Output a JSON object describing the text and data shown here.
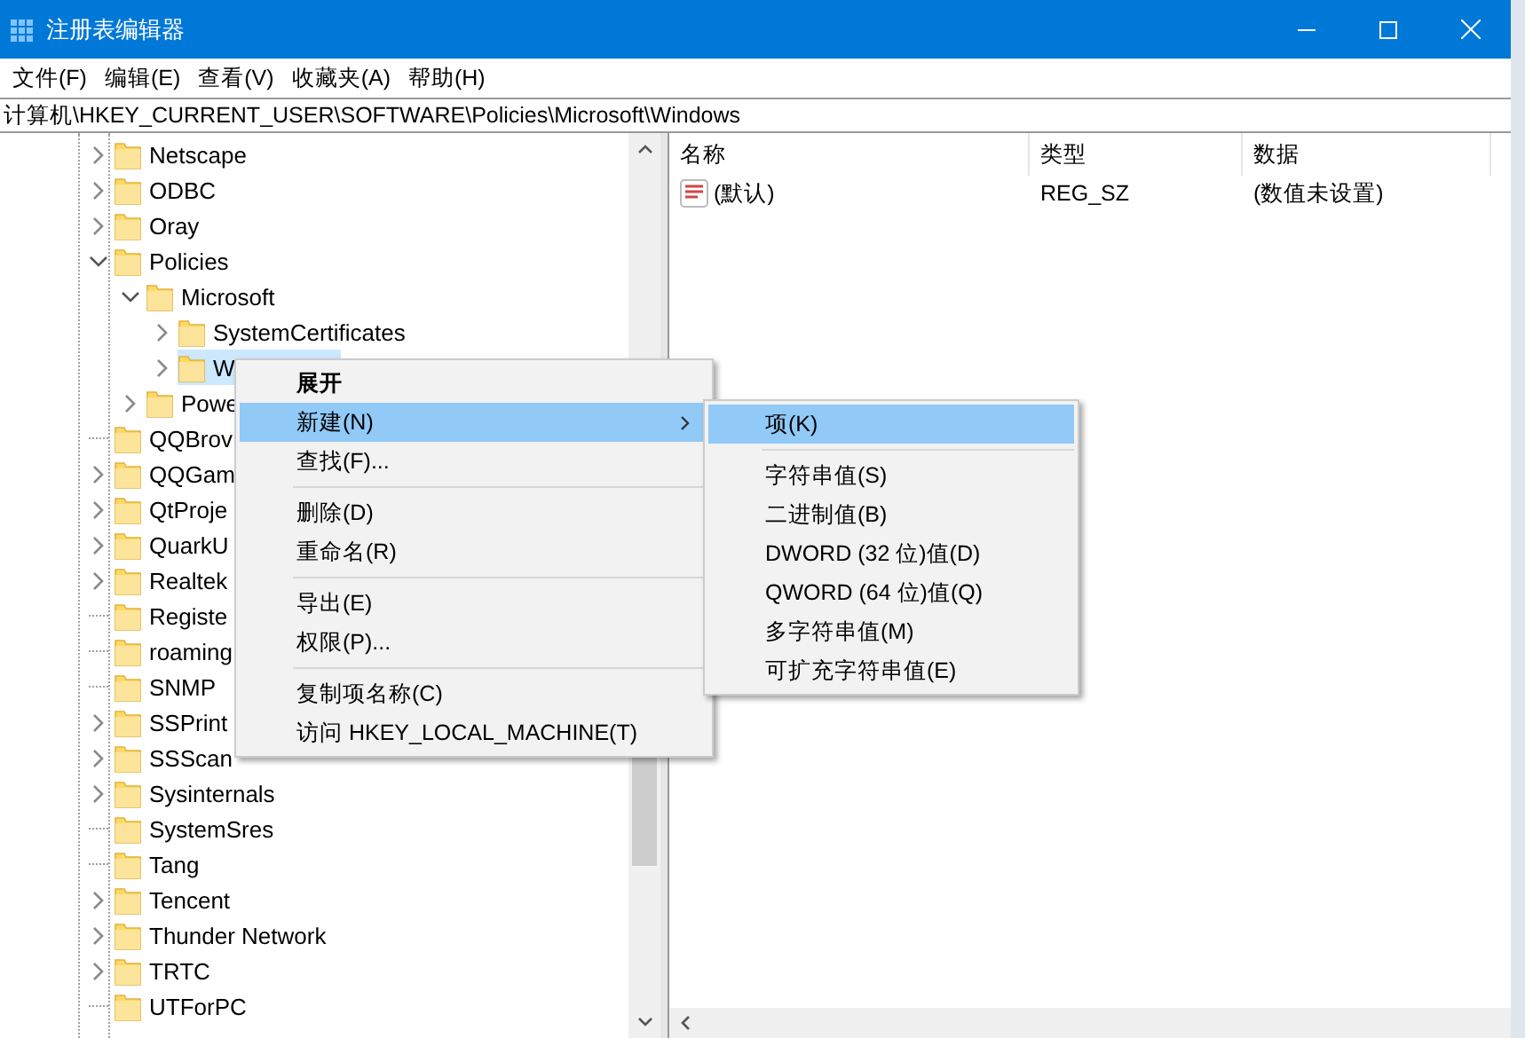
{
  "window": {
    "title": "注册表编辑器"
  },
  "menu_bar": [
    "文件(F)",
    "编辑(E)",
    "查看(V)",
    "收藏夹(A)",
    "帮助(H)"
  ],
  "address": "计算机\\HKEY_CURRENT_USER\\SOFTWARE\\Policies\\Microsoft\\Windows",
  "tree": [
    {
      "label": "Netscape",
      "has_children": true,
      "expanded": false,
      "selected": false
    },
    {
      "label": "ODBC",
      "has_children": true,
      "expanded": false,
      "selected": false
    },
    {
      "label": "Oray",
      "has_children": true,
      "expanded": false,
      "selected": false
    },
    {
      "label": "Policies",
      "has_children": true,
      "expanded": true,
      "selected": false,
      "children": [
        {
          "label": "Microsoft",
          "has_children": true,
          "expanded": true,
          "selected": false,
          "children": [
            {
              "label": "SystemCertificates",
              "has_children": true,
              "expanded": false,
              "selected": false
            },
            {
              "label": "W",
              "has_children": true,
              "expanded": false,
              "selected": true
            }
          ]
        },
        {
          "label": "Powe",
          "has_children": true,
          "expanded": false,
          "selected": false
        }
      ]
    },
    {
      "label": "QQBrov",
      "has_children": false,
      "selected": false
    },
    {
      "label": "QQGam",
      "has_children": true,
      "expanded": false,
      "selected": false
    },
    {
      "label": "QtProje",
      "has_children": true,
      "expanded": false,
      "selected": false
    },
    {
      "label": "QuarkU",
      "has_children": true,
      "expanded": false,
      "selected": false
    },
    {
      "label": "Realtek",
      "has_children": true,
      "expanded": false,
      "selected": false
    },
    {
      "label": "Registe",
      "has_children": false,
      "selected": false
    },
    {
      "label": "roaming",
      "has_children": false,
      "selected": false
    },
    {
      "label": "SNMP",
      "has_children": false,
      "selected": false
    },
    {
      "label": "SSPrint",
      "has_children": true,
      "expanded": false,
      "selected": false
    },
    {
      "label": "SSScan",
      "has_children": true,
      "expanded": false,
      "selected": false
    },
    {
      "label": "Sysinternals",
      "has_children": true,
      "expanded": false,
      "selected": false
    },
    {
      "label": "SystemSres",
      "has_children": false,
      "selected": false
    },
    {
      "label": "Tang",
      "has_children": false,
      "selected": false
    },
    {
      "label": "Tencent",
      "has_children": true,
      "expanded": false,
      "selected": false
    },
    {
      "label": "Thunder Network",
      "has_children": true,
      "expanded": false,
      "selected": false
    },
    {
      "label": "TRTC",
      "has_children": true,
      "expanded": false,
      "selected": false
    },
    {
      "label": "UTForPC",
      "has_children": false,
      "selected": false
    }
  ],
  "values_table": {
    "columns": [
      "名称",
      "类型",
      "数据"
    ],
    "rows": [
      {
        "name": "(默认)",
        "type": "REG_SZ",
        "data": "(数值未设置)"
      }
    ]
  },
  "context_menu": [
    {
      "kind": "item",
      "label": "展开",
      "bold": true,
      "selected": false
    },
    {
      "kind": "item",
      "label": "新建(N)",
      "submenu": true,
      "selected": true
    },
    {
      "kind": "item",
      "label": "查找(F)...",
      "selected": false
    },
    {
      "kind": "separator"
    },
    {
      "kind": "item",
      "label": "删除(D)",
      "selected": false
    },
    {
      "kind": "item",
      "label": "重命名(R)",
      "selected": false
    },
    {
      "kind": "separator"
    },
    {
      "kind": "item",
      "label": "导出(E)",
      "selected": false
    },
    {
      "kind": "item",
      "label": "权限(P)...",
      "selected": false
    },
    {
      "kind": "separator"
    },
    {
      "kind": "item",
      "label": "复制项名称(C)",
      "selected": false
    },
    {
      "kind": "item",
      "label": "访问 HKEY_LOCAL_MACHINE(T)",
      "selected": false
    }
  ],
  "submenu": [
    {
      "kind": "item",
      "label": "项(K)",
      "selected": true
    },
    {
      "kind": "separator"
    },
    {
      "kind": "item",
      "label": "字符串值(S)",
      "selected": false
    },
    {
      "kind": "item",
      "label": "二进制值(B)",
      "selected": false
    },
    {
      "kind": "item",
      "label": "DWORD (32 位)值(D)",
      "selected": false
    },
    {
      "kind": "item",
      "label": "QWORD (64 位)值(Q)",
      "selected": false
    },
    {
      "kind": "item",
      "label": "多字符串值(M)",
      "selected": false
    },
    {
      "kind": "item",
      "label": "可扩充字符串值(E)",
      "selected": false
    }
  ]
}
